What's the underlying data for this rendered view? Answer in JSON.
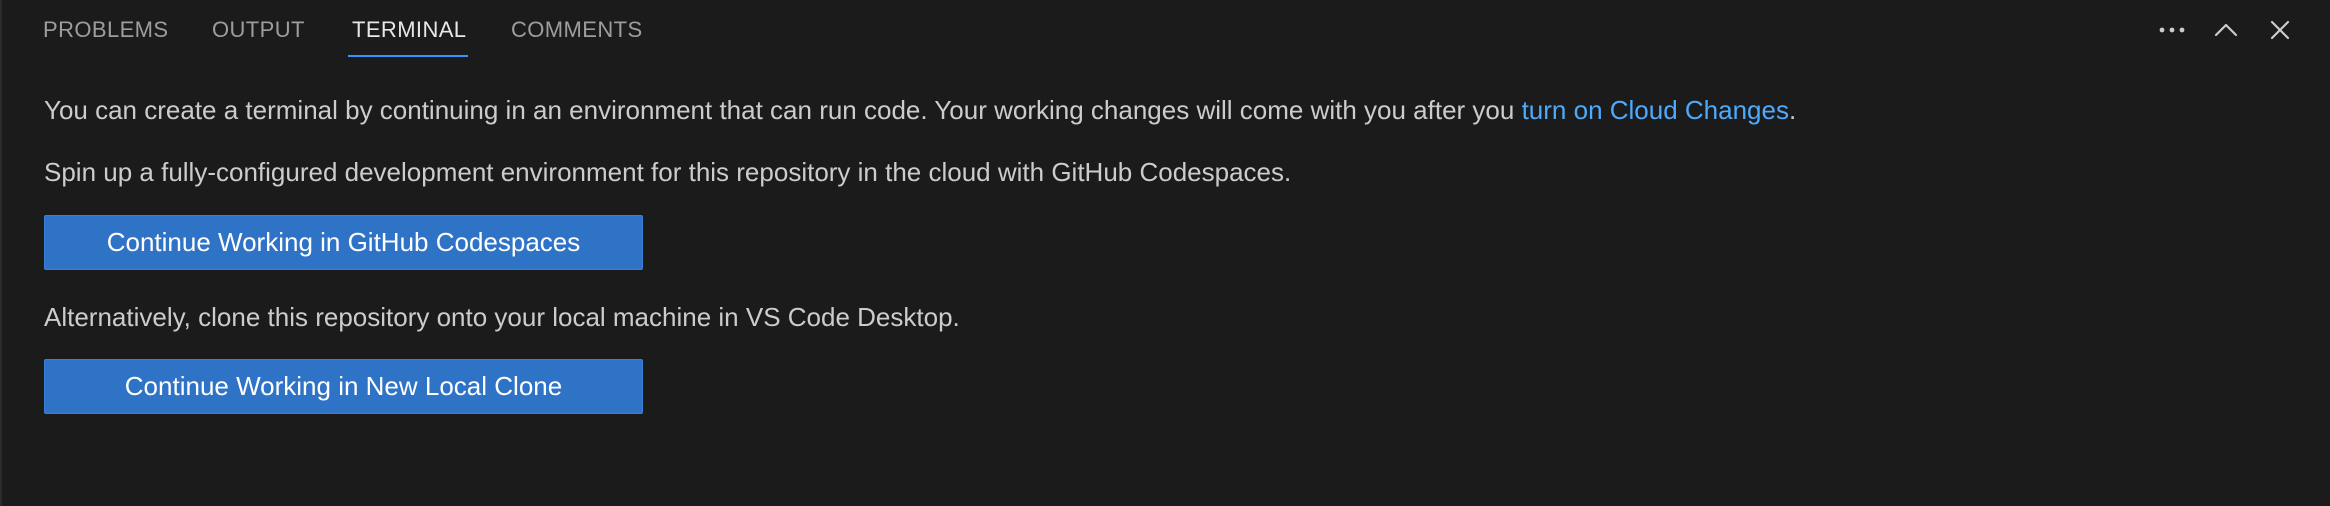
{
  "tabs": [
    {
      "label": "PROBLEMS",
      "active": false
    },
    {
      "label": "OUTPUT",
      "active": false
    },
    {
      "label": "TERMINAL",
      "active": true
    },
    {
      "label": "COMMENTS",
      "active": false
    }
  ],
  "actions": {
    "more": "more-actions-icon",
    "maximize": "chevron-up-icon",
    "close": "close-icon"
  },
  "content": {
    "line1_prefix": "You can create a terminal by continuing in an environment that can run code. Your working changes will come with you after you ",
    "line1_link": "turn on Cloud Changes",
    "line1_suffix": ".",
    "line2": "Spin up a fully-configured development environment for this repository in the cloud with GitHub Codespaces.",
    "button_codespaces": "Continue Working in GitHub Codespaces",
    "line3": "Alternatively, clone this repository onto your local machine in VS Code Desktop.",
    "button_local_clone": "Continue Working in New Local Clone"
  },
  "colors": {
    "background": "#1b1b1b",
    "accent": "#3794ff",
    "link": "#4daafc",
    "button": "#2f73c7"
  }
}
